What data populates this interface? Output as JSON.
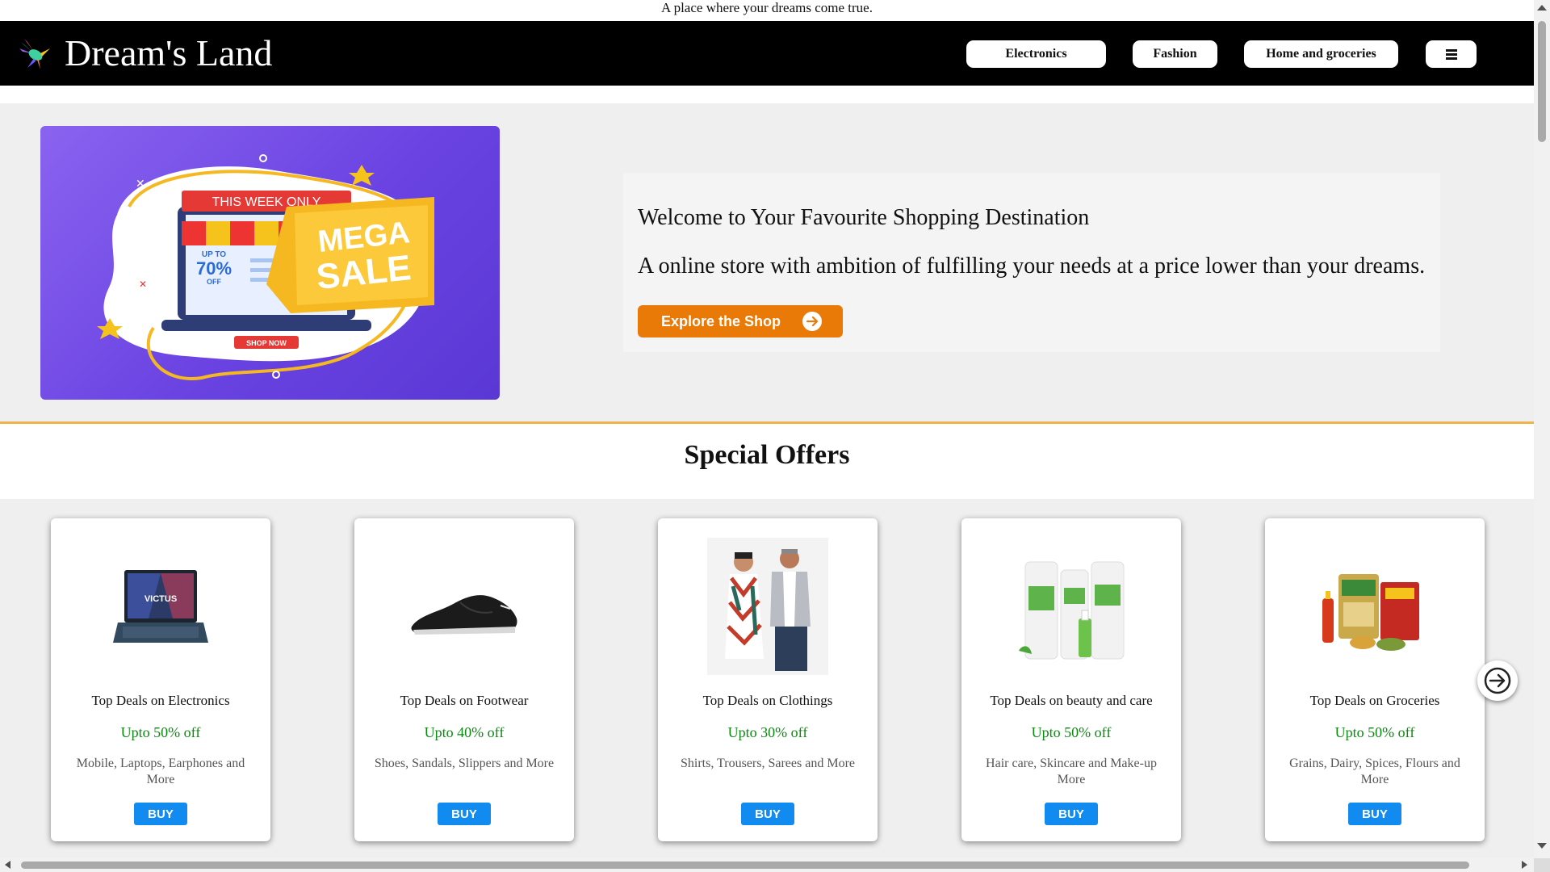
{
  "tagline": "A place where your dreams come true.",
  "header": {
    "brand": "Dream's Land",
    "logo_icon": "hummingbird-logo-icon",
    "nav": [
      "Electronics",
      "Fashion",
      "Home and groceries"
    ],
    "menu_icon": "hamburger-menu-icon"
  },
  "hero": {
    "banner": {
      "week_label": "THIS WEEK ONLY",
      "upto": "UP TO",
      "percent": "70%",
      "off": "OFF",
      "mega": "MEGA",
      "sale": "SALE",
      "shop_now": "SHOP NOW"
    },
    "heading": "Welcome to Your Favourite Shopping Destination",
    "subheading": "A online store with ambition of fulfilling your needs at a price lower than your dreams.",
    "cta": "Explore the Shop"
  },
  "offers": {
    "title": "Special Offers",
    "cards": [
      {
        "title": "Top Deals on Electronics",
        "discount": "Upto 50% off",
        "desc": "Mobile, Laptops, Earphones and More",
        "button": "BUY",
        "image": "laptop-image",
        "brand_text": "VICTUS"
      },
      {
        "title": "Top Deals on Footwear",
        "discount": "Upto 40% off",
        "desc": "Shoes, Sandals, Slippers and More",
        "button": "BUY",
        "image": "sneaker-image"
      },
      {
        "title": "Top Deals on Clothings",
        "discount": "Upto 30% off",
        "desc": "Shirts, Trousers, Sarees and More",
        "button": "BUY",
        "image": "fashion-models-image"
      },
      {
        "title": "Top Deals on beauty and care",
        "discount": "Upto 50% off",
        "desc": "Hair care, Skincare and Make-up More",
        "button": "BUY",
        "image": "skincare-products-image"
      },
      {
        "title": "Top Deals on Groceries",
        "discount": "Upto 50% off",
        "desc": "Grains, Dairy, Spices, Flours and More",
        "button": "BUY",
        "image": "groceries-image"
      }
    ],
    "next_icon": "arrow-right-circle-icon"
  },
  "colors": {
    "header_bg": "#000000",
    "accent_orange": "#ea7a08",
    "buy_blue": "#118bf0",
    "discount_green": "#0b8a12",
    "divider": "#f0b548"
  }
}
